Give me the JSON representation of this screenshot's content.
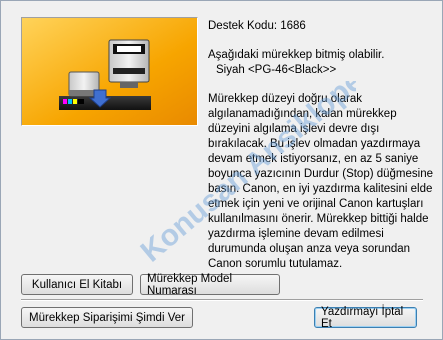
{
  "dialog": {
    "support_code": "Destek Kodu: 1686",
    "warning_line": "Aşağıdaki mürekkep bitmiş olabilir.",
    "ink_name": "Siyah <PG-46<Black>>",
    "body": "Mürekkep düzeyi doğru olarak algılanamadığından, kalan mürekkep düzeyini algılama işlevi devre dışı bırakılacak. Bu işlev olmadan yazdırmaya devam etmek istiyorsanız, en az 5 saniye boyunca yazıcının Durdur (Stop) düğmesine basın. Canon, en iyi yazdırma kalitesini elde etmek için yeni ve orijinal Canon kartuşları kullanılmasını önerir. Mürekkep bittiği halde yazdırma işlemine devam edilmesi durumunda oluşan anza veya sorundan Canon sorumlu tutulamaz."
  },
  "buttons": {
    "manual": "Kullanıcı El Kitabı",
    "model_number": "Mürekkep Model Numarası",
    "order": "Mürekkep Siparişimi Şimdi Ver",
    "cancel": "Yazdırmayı İptal Et"
  },
  "watermark": {
    "text": "Konusan Ansiklopedi"
  },
  "colors": {
    "illustration_bg": "#f7a500",
    "button_border": "#707070",
    "default_button_border": "#3c7fb1",
    "watermark": "#6aa0d8"
  },
  "icons": {
    "arrow": "down-arrow-icon",
    "cartridge": "ink-cartridge-icon",
    "printer": "printer-icon"
  }
}
